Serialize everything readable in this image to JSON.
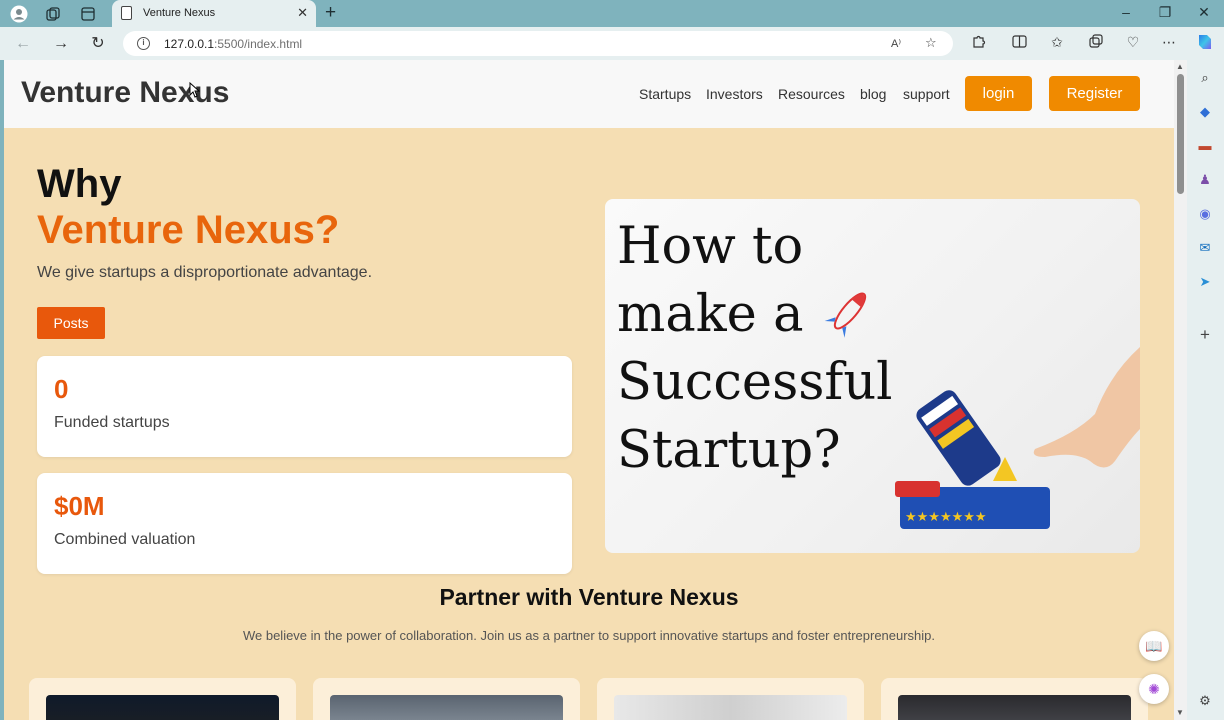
{
  "browser": {
    "tab_title": "Venture Nexus",
    "url_host": "127.0.0.1",
    "url_rest": ":5500/index.html",
    "read_aloud": "A⁾"
  },
  "header": {
    "logo": "Venture Nexus",
    "nav": [
      "Startups",
      "Investors",
      "Resources",
      "blog",
      "support"
    ],
    "login_label": "login",
    "register_label": "Register"
  },
  "hero": {
    "line1": "Why",
    "line2": "Venture Nexus?",
    "tagline": "We give startups a disproportionate advantage.",
    "posts_label": "Posts",
    "image_text": [
      "How to",
      "make a",
      "Successful",
      "Startup?"
    ]
  },
  "stats": [
    {
      "value": "0",
      "label": "Funded startups"
    },
    {
      "value": "$0M",
      "label": "Combined valuation"
    }
  ],
  "partner": {
    "title": "Partner with Venture Nexus",
    "subtitle": "We believe in the power of collaboration. Join us as a partner to support innovative startups and foster entrepreneurship."
  },
  "colors": {
    "accent_orange": "#f08a00",
    "brand_orange": "#e8650c",
    "page_bg": "#f5deb3"
  },
  "icons": {
    "profile": "profile-icon",
    "workspaces": "workspaces-icon",
    "tab_actions": "tab-actions-icon",
    "close": "close-icon",
    "new_tab": "plus-icon",
    "back": "back-arrow-icon",
    "forward": "forward-arrow-icon",
    "refresh": "refresh-icon",
    "info": "info-icon",
    "favorite": "star-icon",
    "extensions": "puzzle-icon",
    "split": "split-screen-icon",
    "favorites": "favorites-icon",
    "collections": "collections-icon",
    "performance": "heart-pulse-icon",
    "more": "more-icon",
    "copilot": "copilot-icon"
  }
}
